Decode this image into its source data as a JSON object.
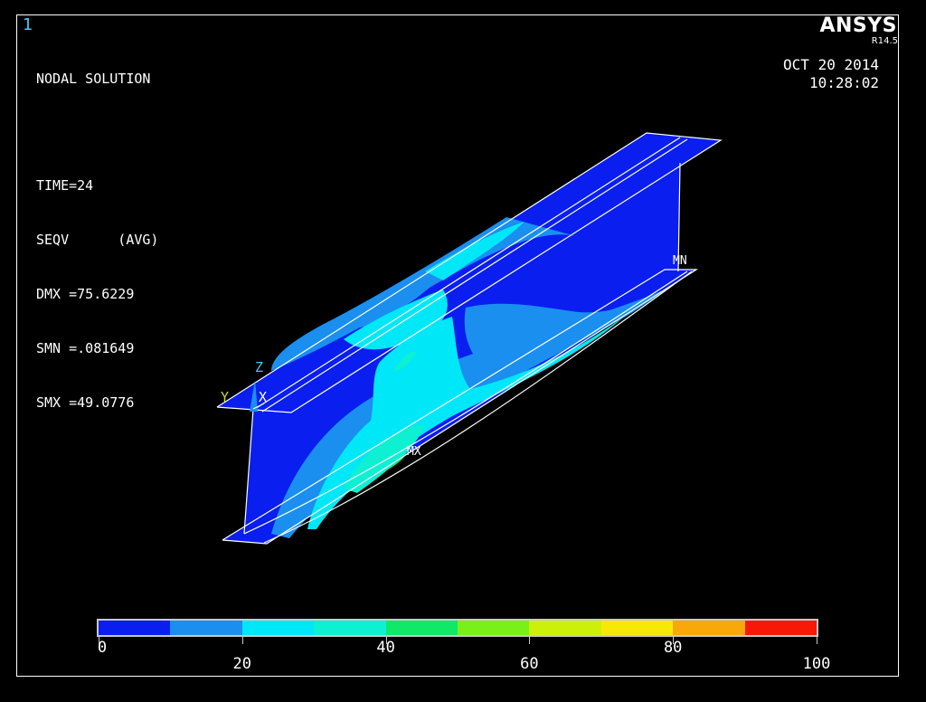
{
  "window_number": "1",
  "solution": {
    "title": "NODAL SOLUTION",
    "time": "TIME=24",
    "result": "SEQV      (AVG)",
    "dmx": "DMX =75.6229",
    "smn": "SMN =.081649",
    "smx": "SMX =49.0776"
  },
  "brand": {
    "name": "ANSYS",
    "version": "R14.5"
  },
  "timestamp": {
    "date": "OCT 20 2014",
    "time": "10:28:02"
  },
  "axis_triad": {
    "z": "Z",
    "y": "Y",
    "x": "X"
  },
  "markers": {
    "min": "MN",
    "max": "MX"
  },
  "legend": {
    "colors": [
      "#0a1ef0",
      "#1a8ff0",
      "#00e8f8",
      "#0ef0d2",
      "#10e868",
      "#7af018",
      "#ccf00a",
      "#f8e808",
      "#f8a808",
      "#f81808"
    ],
    "labels_top": [
      "0",
      "40",
      "80"
    ],
    "labels_bottom": [
      "20",
      "60",
      "100"
    ]
  },
  "contour_colors": {
    "level1": "#0a1ef0",
    "level2": "#1a8ff0",
    "level3": "#00e8f8",
    "level4": "#10e868"
  }
}
